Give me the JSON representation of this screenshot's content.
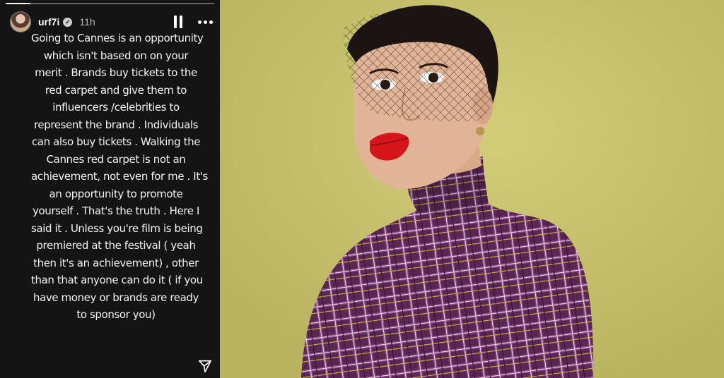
{
  "story": {
    "progress": 0.12,
    "username": "urf7i",
    "timestamp": "11h",
    "text_lines": [
      "Going to Cannes is an opportunity",
      "which isn't based on on your",
      "merit . Brands buy tickets to the",
      "red carpet and give them to",
      "influencers /celebrities to",
      "represent the brand . Individuals",
      "can also buy tickets . Walking the",
      "Cannes red carpet is not an",
      "achievement, not even for me . It's",
      "an opportunity to promote",
      "yourself . That's the truth . Here I",
      "said it . Unless you're film is being",
      "premiered at the festival ( yeah",
      "then it's an achievement) , other",
      "than that anyone can do it ( if you",
      "have money or brands are ready",
      "to sponsor you)"
    ],
    "icons": {
      "avatar": "profile-avatar",
      "verified": "verified-badge-icon",
      "pause": "pause-icon",
      "more": "more-options-icon",
      "send": "send-icon"
    }
  },
  "photo": {
    "subject": "portrait-photo",
    "colors": {
      "background": "#c6c16a",
      "dress_purple": "#5a2752",
      "lips": "#d5151a"
    }
  }
}
